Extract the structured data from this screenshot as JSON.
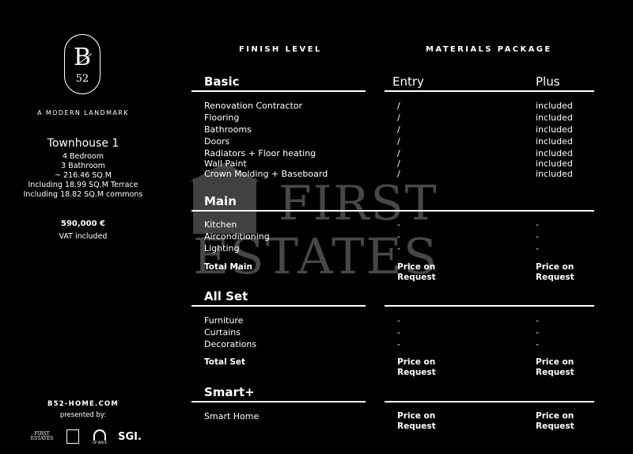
{
  "brand": {
    "logo_letter": "B",
    "logo_number": "52",
    "tagline": "A MODERN LANDMARK"
  },
  "unit": {
    "title": "Townhouse 1",
    "details": [
      "4 Bedroom",
      "3 Bathroom",
      "~ 216.46 SQ.M",
      "Including 18.99 SQ.M Terrace",
      "Including 18.82 SQ.M commons"
    ],
    "price": "590,000 €",
    "vat": "VAT included"
  },
  "footer": {
    "website": "B52-HOME.COM",
    "presented_by": "presented by:",
    "partner1": [
      "FIRST",
      "ESTATES"
    ],
    "partner3": "UP WALK",
    "partner4": "SGI."
  },
  "watermark": {
    "line1": "FIRST",
    "line2": "ESTATES"
  },
  "headers": {
    "finish_level": "FINISH LEVEL",
    "materials_package": "MATERIALS PACKAGE",
    "entry": "Entry",
    "plus": "Plus"
  },
  "sections": {
    "basic": {
      "title": "Basic",
      "items": [
        {
          "name": "Renovation Contractor",
          "entry": "/",
          "plus": "included"
        },
        {
          "name": "Flooring",
          "entry": "/",
          "plus": "included"
        },
        {
          "name": "Bathrooms",
          "entry": "/",
          "plus": "included"
        },
        {
          "name": "Doors",
          "entry": "/",
          "plus": "included"
        },
        {
          "name": "Radiators + Floor heating",
          "entry": "/",
          "plus": "included"
        },
        {
          "name": "Wall Paint",
          "entry": "/",
          "plus": "included"
        },
        {
          "name": "Crown Molding + Baseboard",
          "entry": "/",
          "plus": "included"
        }
      ]
    },
    "main": {
      "title": "Main",
      "items": [
        {
          "name": "Kitchen",
          "entry": "-",
          "plus": "-"
        },
        {
          "name": "Airconditioning",
          "entry": "-",
          "plus": "-"
        },
        {
          "name": "Lighting",
          "entry": "-",
          "plus": "-"
        }
      ],
      "total": {
        "name": "Total Main",
        "entry": [
          "Price on",
          "Request"
        ],
        "plus": [
          "Price on",
          "Request"
        ]
      }
    },
    "allset": {
      "title": "All Set",
      "items": [
        {
          "name": "Furniture",
          "entry": "-",
          "plus": "-"
        },
        {
          "name": "Curtains",
          "entry": "-",
          "plus": "-"
        },
        {
          "name": "Decorations",
          "entry": "-",
          "plus": "-"
        }
      ],
      "total": {
        "name": "Total Set",
        "entry": [
          "Price on",
          "Request"
        ],
        "plus": [
          "Price on",
          "Request"
        ]
      }
    },
    "smart": {
      "title": "Smart+",
      "items": [
        {
          "name": "Smart Home",
          "entry": [
            "Price on",
            "Request"
          ],
          "plus": [
            "Price on",
            "Request"
          ]
        }
      ]
    }
  }
}
